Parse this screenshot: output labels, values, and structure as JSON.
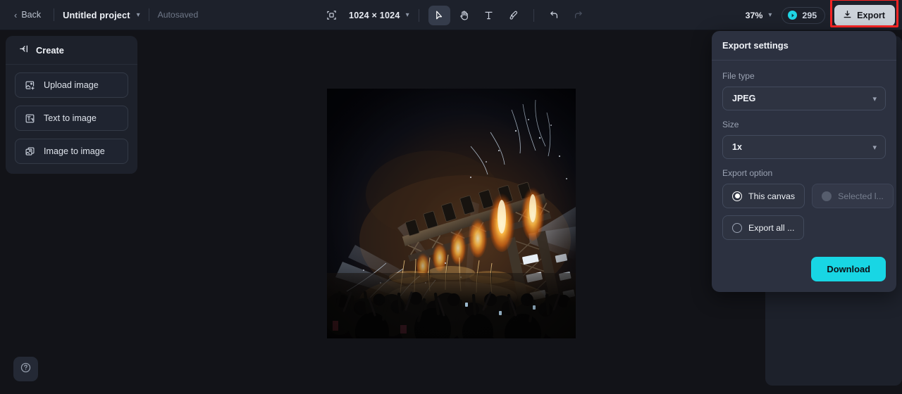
{
  "topbar": {
    "back_label": "Back",
    "project_name": "Untitled project",
    "autosave_status": "Autosaved",
    "canvas_size": "1024 × 1024",
    "zoom_level": "37%",
    "credits": "295",
    "export_label": "Export",
    "tools": [
      {
        "name": "frame-resize-icon",
        "label": "Frame size"
      },
      {
        "name": "select-tool",
        "label": "Select"
      },
      {
        "name": "hand-tool",
        "label": "Pan"
      },
      {
        "name": "text-tool",
        "label": "Text"
      },
      {
        "name": "brush-tool",
        "label": "Brush"
      },
      {
        "name": "undo-button",
        "label": "Undo"
      },
      {
        "name": "redo-button",
        "label": "Redo"
      }
    ]
  },
  "sidebar": {
    "title": "Create",
    "items": [
      {
        "label": "Upload image",
        "icon": "upload-image-icon"
      },
      {
        "label": "Text to image",
        "icon": "text-to-image-icon"
      },
      {
        "label": "Image to image",
        "icon": "image-to-image-icon"
      }
    ]
  },
  "help": {
    "label": "?"
  },
  "export_panel": {
    "title": "Export settings",
    "file_type_label": "File type",
    "file_type_value": "JPEG",
    "size_label": "Size",
    "size_value": "1x",
    "export_option_label": "Export option",
    "options": [
      {
        "label": "This canvas",
        "selected": true,
        "disabled": false
      },
      {
        "label": "Selected l...",
        "selected": false,
        "disabled": true
      },
      {
        "label": "Export all ...",
        "selected": false,
        "disabled": false
      }
    ],
    "download_label": "Download"
  },
  "canvas": {
    "image_description": "Night concert stage with pyrotechnics, fire jets, sparks, light beams and a silhouetted crowd"
  },
  "colors": {
    "topbar_bg": "#1d212b",
    "panel_bg": "#1d212b",
    "popup_bg": "#2c3140",
    "canvas_bg": "#121318",
    "accent_cyan": "#18d6e4",
    "highlight_red": "#fb2424",
    "export_btn_bg": "#ccd2da"
  }
}
